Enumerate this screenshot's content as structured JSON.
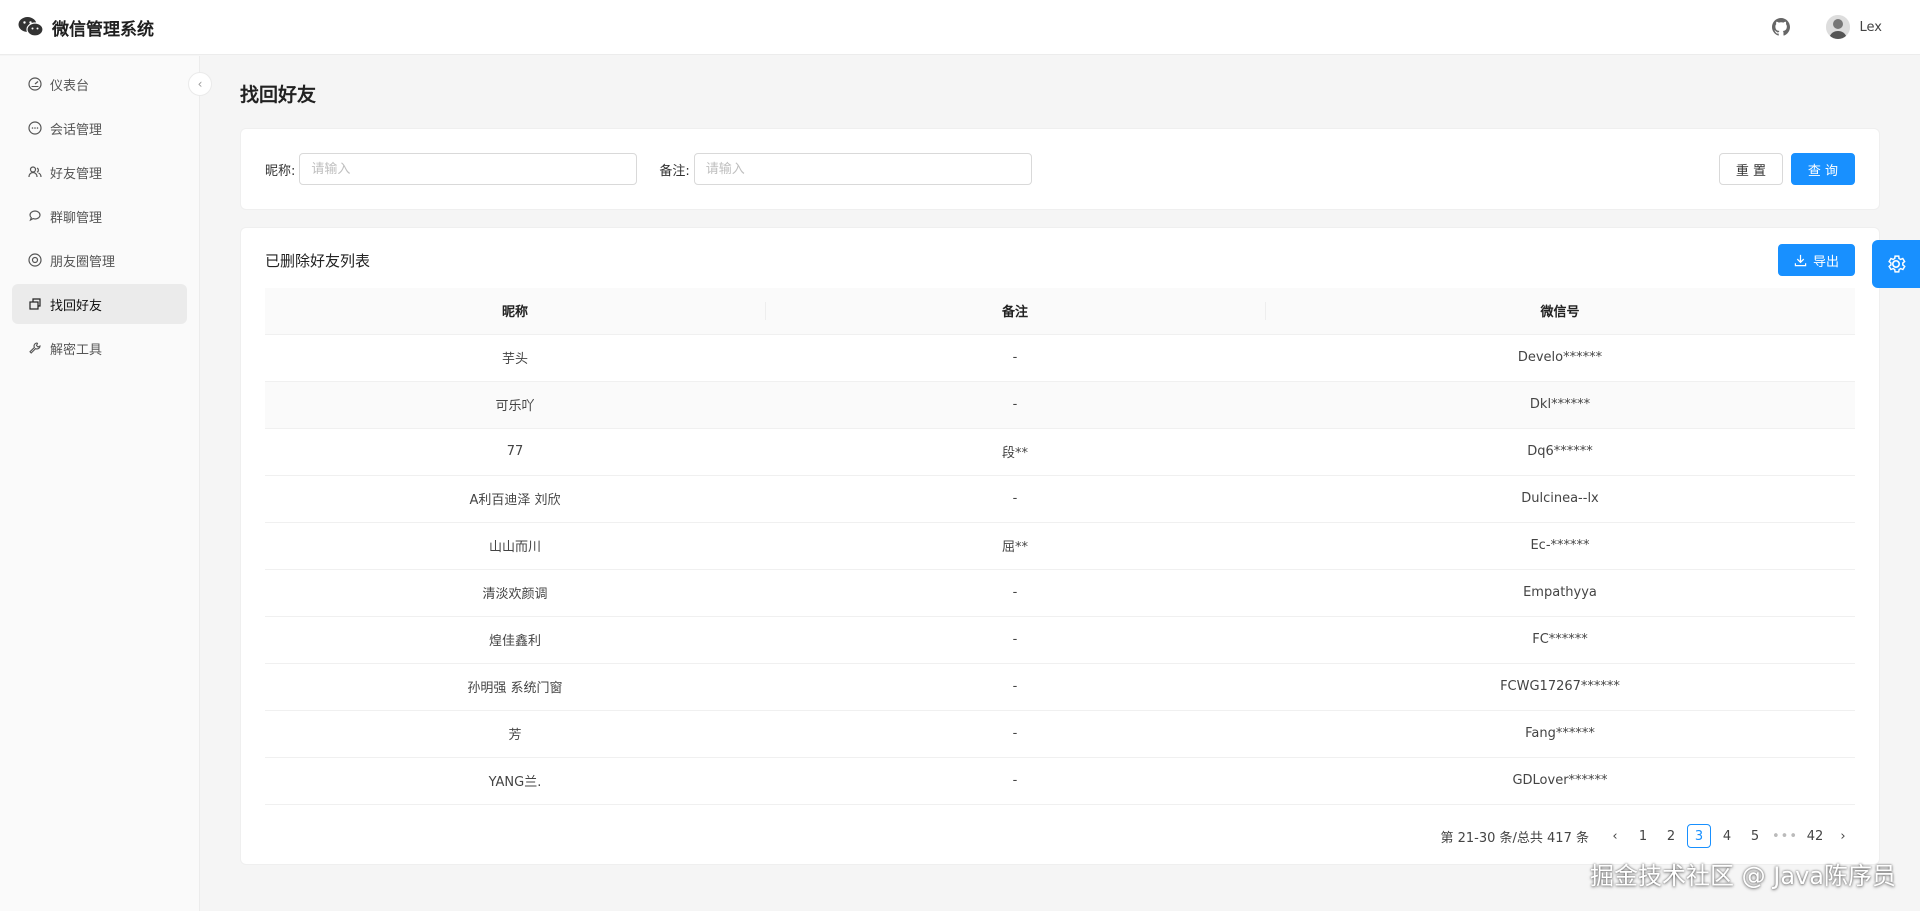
{
  "app": {
    "title": "微信管理系统"
  },
  "header": {
    "user_name": "Lex"
  },
  "sidebar": {
    "items": [
      {
        "label": "仪表台",
        "icon": "dashboard-icon"
      },
      {
        "label": "会话管理",
        "icon": "chat-icon"
      },
      {
        "label": "好友管理",
        "icon": "users-icon"
      },
      {
        "label": "群聊管理",
        "icon": "group-chat-icon"
      },
      {
        "label": "朋友圈管理",
        "icon": "moments-icon"
      },
      {
        "label": "找回好友",
        "icon": "recover-icon",
        "active": true
      },
      {
        "label": "解密工具",
        "icon": "tool-icon"
      }
    ]
  },
  "page": {
    "title": "找回好友"
  },
  "search": {
    "nickname_label": "昵称:",
    "nickname_placeholder": "请输入",
    "remark_label": "备注:",
    "remark_placeholder": "请输入",
    "reset_label": "重 置",
    "query_label": "查 询"
  },
  "table": {
    "title": "已删除好友列表",
    "export_label": "导出",
    "columns": [
      "昵称",
      "备注",
      "微信号"
    ],
    "rows": [
      [
        "芋头",
        "-",
        "Develo******"
      ],
      [
        "可乐吖",
        "-",
        "Dkl******"
      ],
      [
        "77",
        "段**",
        "Dq6******"
      ],
      [
        "A利百迪泽 刘欣",
        "-",
        "Dulcinea--lx"
      ],
      [
        "山山而川",
        "屈**",
        "Ec-******"
      ],
      [
        "清淡欢颜调",
        "-",
        "Empathyya"
      ],
      [
        "煌佳鑫利",
        "-",
        "FC******"
      ],
      [
        "孙明强 系统门窗",
        "-",
        "FCWG17267******"
      ],
      [
        "芳",
        "-",
        "Fang******"
      ],
      [
        "YANG兰.",
        "-",
        "GDLover******"
      ]
    ]
  },
  "pagination": {
    "total_text": "第 21-30 条/总共 417 条",
    "pages": [
      "1",
      "2",
      "3",
      "4",
      "5"
    ],
    "current": "3",
    "ellipsis": "•••",
    "last": "42"
  },
  "watermark": "掘金技术社区 @ Java陈序员",
  "colors": {
    "primary": "#1890ff"
  }
}
